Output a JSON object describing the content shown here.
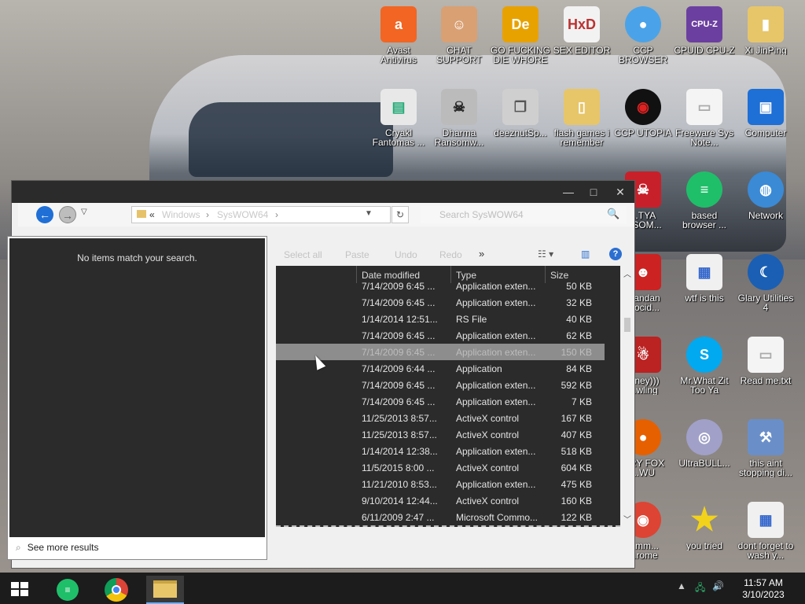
{
  "desktop": {
    "icons": [
      {
        "label": "Avast Antivirus",
        "icon": "avast-icon",
        "color": "#f26522"
      },
      {
        "label": "CHAT SUPPORT",
        "icon": "support-person-icon",
        "color": "#d9a073"
      },
      {
        "label": "GO FUCKING DIE WHORE",
        "icon": "de-app-icon",
        "color": "#e8a200"
      },
      {
        "label": "SEX EDITOR",
        "icon": "hxd-icon",
        "color": "#f2f2f2"
      },
      {
        "label": "CCP BROWSER",
        "icon": "chromium-icon",
        "color": "#4aa3e8"
      },
      {
        "label": "CPUID CPU-Z",
        "icon": "cpuz-icon",
        "color": "#6b3fa0"
      },
      {
        "label": "Xi JinPing",
        "icon": "user-folder-icon",
        "color": "#e7c66a"
      },
      {
        "label": "Cryakl Fantomas ...",
        "icon": "window-app-icon",
        "color": "#e8e8e8"
      },
      {
        "label": "Dharma Ransomw...",
        "icon": "skull-icon",
        "color": "#bbbbbb"
      },
      {
        "label": "deeznutSp...",
        "icon": "copy-windows-icon",
        "color": "#cfcfcf"
      },
      {
        "label": "flash games i remember",
        "icon": "folder-icon",
        "color": "#e7c66a"
      },
      {
        "label": "CCP UTOPIA",
        "icon": "utopia-icon",
        "color": "#111111"
      },
      {
        "label": "Freeware Sys Note...",
        "icon": "document-icon",
        "color": "#f4f4f4"
      },
      {
        "label": "Computer",
        "icon": "computer-icon",
        "color": "#1e6fd6"
      },
      {
        "label": "...TYA ...SOM...",
        "icon": "skull-red-icon",
        "color": "#c8202a"
      },
      {
        "label": "based browser ...",
        "icon": "chat-bubble-icon",
        "color": "#1fbf6a"
      },
      {
        "label": "Network",
        "icon": "network-icon",
        "color": "#3a8ad6"
      },
      {
        "label": "...andan ...ocid...",
        "icon": "meme-icon",
        "color": "#cc2222"
      },
      {
        "label": "wtf is this",
        "icon": "config-file-icon",
        "color": "#f0f0f0"
      },
      {
        "label": "Glary Utilities 4",
        "icon": "glary-icon",
        "color": "#1a5fb4"
      },
      {
        "label": "...ney))) ...wling",
        "icon": "santa-icon",
        "color": "#bb2222"
      },
      {
        "label": "Mr.What Zit Too Ya",
        "icon": "skype-icon",
        "color": "#00a9f0"
      },
      {
        "label": "Read me.txt",
        "icon": "text-file-icon",
        "color": "#f4f4f4"
      },
      {
        "label": "...RY FOX ...WU",
        "icon": "firefox-icon",
        "color": "#e66000"
      },
      {
        "label": "UltraBULL...",
        "icon": "disc-icon",
        "color": "#a0a0c8"
      },
      {
        "label": "this aint stopping di...",
        "icon": "computer-wrench-icon",
        "color": "#6a8fc8"
      },
      {
        "label": "...mm... ...rome",
        "icon": "chrome-icon",
        "color": "#dd4433"
      },
      {
        "label": "you tried",
        "icon": "star-icon",
        "color": "#f2d21b"
      },
      {
        "label": "dont forget to wash y...",
        "icon": "config-file-icon",
        "color": "#f0f0f0"
      }
    ]
  },
  "explorer": {
    "controls": {
      "minimize": "—",
      "maximize": "□",
      "close": "✕"
    },
    "nav": {
      "back": "←",
      "forward": "→",
      "history": "▽"
    },
    "address": {
      "prefix": "«",
      "segments": [
        "Windows",
        "SysWOW64"
      ],
      "sep": "›"
    },
    "search_placeholder": "Search SysWOW64",
    "commands": {
      "select_all": "Select all",
      "paste": "Paste",
      "undo": "Undo",
      "redo": "Redo",
      "more": "»"
    },
    "columns": {
      "date": "Date modified",
      "type": "Type",
      "size": "Size"
    },
    "rows": [
      {
        "date": "7/14/2009 6:45 ...",
        "type": "Application exten...",
        "size": "50 KB"
      },
      {
        "date": "7/14/2009 6:45 ...",
        "type": "Application exten...",
        "size": "32 KB"
      },
      {
        "date": "1/14/2014 12:51...",
        "type": "RS File",
        "size": "40 KB"
      },
      {
        "date": "7/14/2009 6:45 ...",
        "type": "Application exten...",
        "size": "62 KB"
      },
      {
        "date": "7/14/2009 6:45 ...",
        "type": "Application exten...",
        "size": "150 KB",
        "selected": true
      },
      {
        "date": "7/14/2009 6:44 ...",
        "type": "Application",
        "size": "84 KB"
      },
      {
        "date": "7/14/2009 6:45 ...",
        "type": "Application exten...",
        "size": "592 KB"
      },
      {
        "date": "7/14/2009 6:45 ...",
        "type": "Application exten...",
        "size": "7 KB"
      },
      {
        "date": "11/25/2013 8:57...",
        "type": "ActiveX control",
        "size": "167 KB"
      },
      {
        "date": "11/25/2013 8:57...",
        "type": "ActiveX control",
        "size": "407 KB"
      },
      {
        "date": "1/14/2014 12:38...",
        "type": "Application exten...",
        "size": "518 KB"
      },
      {
        "date": "11/5/2015 8:00 ...",
        "type": "ActiveX control",
        "size": "604 KB"
      },
      {
        "date": "11/21/2010 8:53...",
        "type": "Application exten...",
        "size": "475 KB"
      },
      {
        "date": "9/10/2014 12:44...",
        "type": "ActiveX control",
        "size": "160 KB"
      },
      {
        "date": "6/11/2009 2:47 ...",
        "type": "Microsoft Commo...",
        "size": "122 KB"
      }
    ]
  },
  "search_popup": {
    "no_items": "No items match your search.",
    "see_more": "See more results"
  },
  "taskbar": {
    "apps": [
      {
        "name": "based-browser",
        "icon": "chat-bubble-icon",
        "color": "#1fbf6a"
      },
      {
        "name": "chrome",
        "icon": "chrome-icon",
        "color": "#dd4433"
      },
      {
        "name": "file-explorer",
        "icon": "folder-icon",
        "color": "#e7c66a",
        "active": true
      }
    ],
    "tray": {
      "chevron": "▲",
      "network": "🖧",
      "volume": "🔊"
    },
    "time": "11:57 AM",
    "date": "3/10/2023"
  }
}
